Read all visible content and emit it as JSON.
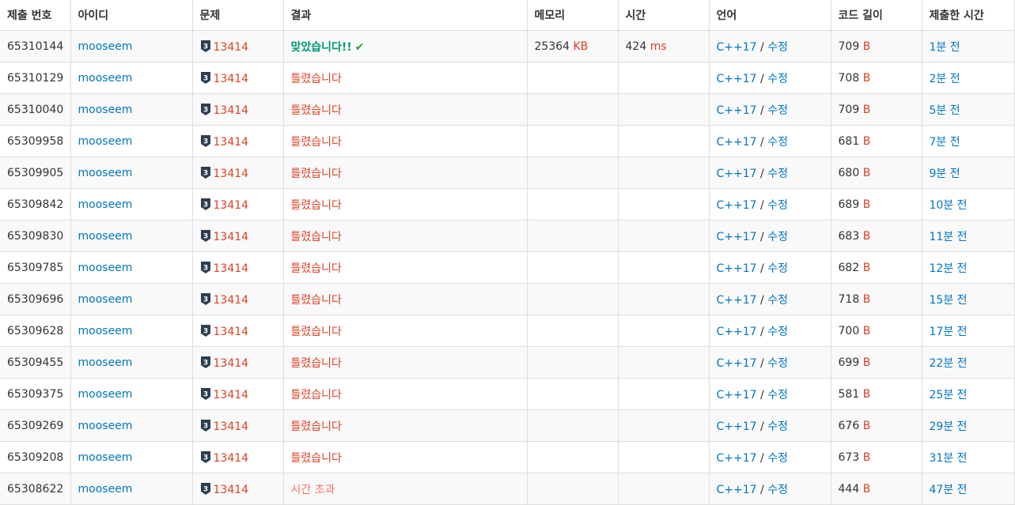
{
  "columns": [
    "제출 번호",
    "아이디",
    "문제",
    "결과",
    "메모리",
    "시간",
    "언어",
    "코드 길이",
    "제출한 시간"
  ],
  "rows": [
    {
      "id": "65310144",
      "user": "mooseem",
      "tier": "3",
      "problem": "13414",
      "result": "맞았습니다!!",
      "status": "accepted",
      "memory": "25364",
      "memory_unit": "KB",
      "time": "424",
      "time_unit": "ms",
      "lang": "C++17",
      "edit": "수정",
      "len": "709",
      "len_unit": "B",
      "when": "1분 전"
    },
    {
      "id": "65310129",
      "user": "mooseem",
      "tier": "3",
      "problem": "13414",
      "result": "틀렸습니다",
      "status": "wrong",
      "memory": "",
      "memory_unit": "",
      "time": "",
      "time_unit": "",
      "lang": "C++17",
      "edit": "수정",
      "len": "708",
      "len_unit": "B",
      "when": "2분 전"
    },
    {
      "id": "65310040",
      "user": "mooseem",
      "tier": "3",
      "problem": "13414",
      "result": "틀렸습니다",
      "status": "wrong",
      "memory": "",
      "memory_unit": "",
      "time": "",
      "time_unit": "",
      "lang": "C++17",
      "edit": "수정",
      "len": "709",
      "len_unit": "B",
      "when": "5분 전"
    },
    {
      "id": "65309958",
      "user": "mooseem",
      "tier": "3",
      "problem": "13414",
      "result": "틀렸습니다",
      "status": "wrong",
      "memory": "",
      "memory_unit": "",
      "time": "",
      "time_unit": "",
      "lang": "C++17",
      "edit": "수정",
      "len": "681",
      "len_unit": "B",
      "when": "7분 전"
    },
    {
      "id": "65309905",
      "user": "mooseem",
      "tier": "3",
      "problem": "13414",
      "result": "틀렸습니다",
      "status": "wrong",
      "memory": "",
      "memory_unit": "",
      "time": "",
      "time_unit": "",
      "lang": "C++17",
      "edit": "수정",
      "len": "680",
      "len_unit": "B",
      "when": "9분 전"
    },
    {
      "id": "65309842",
      "user": "mooseem",
      "tier": "3",
      "problem": "13414",
      "result": "틀렸습니다",
      "status": "wrong",
      "memory": "",
      "memory_unit": "",
      "time": "",
      "time_unit": "",
      "lang": "C++17",
      "edit": "수정",
      "len": "689",
      "len_unit": "B",
      "when": "10분 전"
    },
    {
      "id": "65309830",
      "user": "mooseem",
      "tier": "3",
      "problem": "13414",
      "result": "틀렸습니다",
      "status": "wrong",
      "memory": "",
      "memory_unit": "",
      "time": "",
      "time_unit": "",
      "lang": "C++17",
      "edit": "수정",
      "len": "683",
      "len_unit": "B",
      "when": "11분 전"
    },
    {
      "id": "65309785",
      "user": "mooseem",
      "tier": "3",
      "problem": "13414",
      "result": "틀렸습니다",
      "status": "wrong",
      "memory": "",
      "memory_unit": "",
      "time": "",
      "time_unit": "",
      "lang": "C++17",
      "edit": "수정",
      "len": "682",
      "len_unit": "B",
      "when": "12분 전"
    },
    {
      "id": "65309696",
      "user": "mooseem",
      "tier": "3",
      "problem": "13414",
      "result": "틀렸습니다",
      "status": "wrong",
      "memory": "",
      "memory_unit": "",
      "time": "",
      "time_unit": "",
      "lang": "C++17",
      "edit": "수정",
      "len": "718",
      "len_unit": "B",
      "when": "15분 전"
    },
    {
      "id": "65309628",
      "user": "mooseem",
      "tier": "3",
      "problem": "13414",
      "result": "틀렸습니다",
      "status": "wrong",
      "memory": "",
      "memory_unit": "",
      "time": "",
      "time_unit": "",
      "lang": "C++17",
      "edit": "수정",
      "len": "700",
      "len_unit": "B",
      "when": "17분 전"
    },
    {
      "id": "65309455",
      "user": "mooseem",
      "tier": "3",
      "problem": "13414",
      "result": "틀렸습니다",
      "status": "wrong",
      "memory": "",
      "memory_unit": "",
      "time": "",
      "time_unit": "",
      "lang": "C++17",
      "edit": "수정",
      "len": "699",
      "len_unit": "B",
      "when": "22분 전"
    },
    {
      "id": "65309375",
      "user": "mooseem",
      "tier": "3",
      "problem": "13414",
      "result": "틀렸습니다",
      "status": "wrong",
      "memory": "",
      "memory_unit": "",
      "time": "",
      "time_unit": "",
      "lang": "C++17",
      "edit": "수정",
      "len": "581",
      "len_unit": "B",
      "when": "25분 전"
    },
    {
      "id": "65309269",
      "user": "mooseem",
      "tier": "3",
      "problem": "13414",
      "result": "틀렸습니다",
      "status": "wrong",
      "memory": "",
      "memory_unit": "",
      "time": "",
      "time_unit": "",
      "lang": "C++17",
      "edit": "수정",
      "len": "676",
      "len_unit": "B",
      "when": "29분 전"
    },
    {
      "id": "65309208",
      "user": "mooseem",
      "tier": "3",
      "problem": "13414",
      "result": "틀렸습니다",
      "status": "wrong",
      "memory": "",
      "memory_unit": "",
      "time": "",
      "time_unit": "",
      "lang": "C++17",
      "edit": "수정",
      "len": "673",
      "len_unit": "B",
      "when": "31분 전"
    },
    {
      "id": "65308622",
      "user": "mooseem",
      "tier": "3",
      "problem": "13414",
      "result": "시간 초과",
      "status": "tle",
      "memory": "",
      "memory_unit": "",
      "time": "",
      "time_unit": "",
      "lang": "C++17",
      "edit": "수정",
      "len": "444",
      "len_unit": "B",
      "when": "47분 전"
    }
  ],
  "colors": {
    "link": "#0076c0",
    "accepted": "#009874",
    "wrong": "#dd4124",
    "tle": "#fa7268",
    "tier_badge": "#2d3e50",
    "row_stripe": "#f9f9f9",
    "border": "#dddddd"
  },
  "icons": {
    "tier": "tier-badge-icon",
    "check": "checkmark-icon"
  }
}
